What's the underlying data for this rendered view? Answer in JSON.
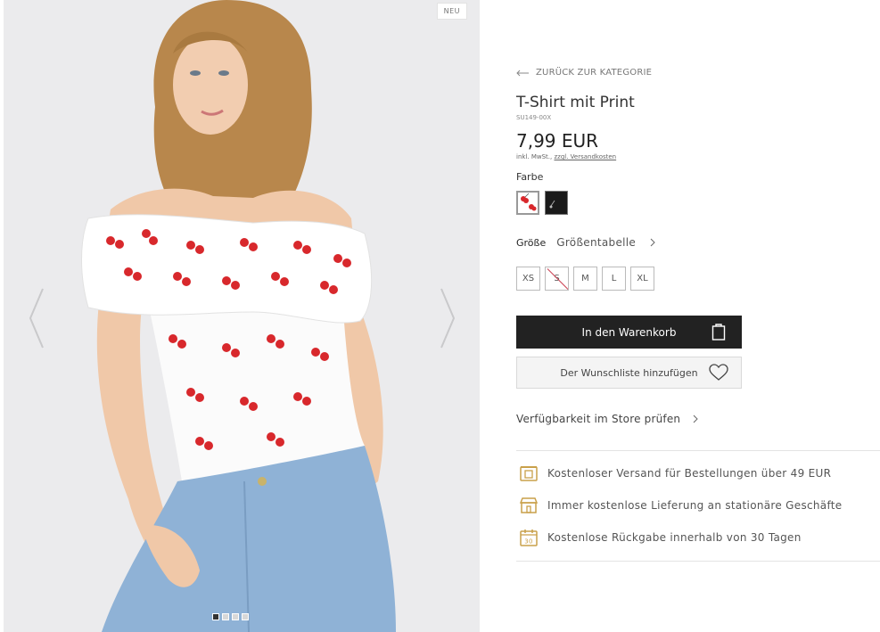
{
  "gallery": {
    "badge": "NEU",
    "slides": 4,
    "active_slide": 0
  },
  "product": {
    "back_label": "ZURÜCK ZUR KATEGORIE",
    "title": "T-Shirt mit Print",
    "sku": "SU149-00X",
    "price": "7,99 EUR",
    "tax_note": "inkl. MwSt.,",
    "shipping_link": "zzgl. Versandkosten",
    "color_label": "Farbe",
    "colors": [
      {
        "name": "white-cherry",
        "hex": "#ffffff",
        "selected": true
      },
      {
        "name": "black",
        "hex": "#1a1a1a",
        "selected": false
      }
    ],
    "size_label": "Größe",
    "size_table": "Größentabelle",
    "sizes": [
      {
        "label": "XS",
        "available": true
      },
      {
        "label": "S",
        "available": false
      },
      {
        "label": "M",
        "available": true
      },
      {
        "label": "L",
        "available": true
      },
      {
        "label": "XL",
        "available": true
      }
    ],
    "cart_button": "In den Warenkorb",
    "wishlist_button": "Der Wunschliste hinzufügen",
    "store_check": "Verfügbarkeit im Store prüfen"
  },
  "benefits": [
    {
      "icon": "shipping-box-icon",
      "text": "Kostenloser Versand für Bestellungen über 49 EUR"
    },
    {
      "icon": "store-icon",
      "text": "Immer kostenlose Lieferung an stationäre Geschäfte"
    },
    {
      "icon": "calendar-30-icon",
      "text": "Kostenlose Rückgabe innerhalb von 30 Tagen"
    }
  ],
  "colors": {
    "accent": "#c9a04a",
    "primary_button": "#222222",
    "cherry_red": "#d8282c"
  }
}
